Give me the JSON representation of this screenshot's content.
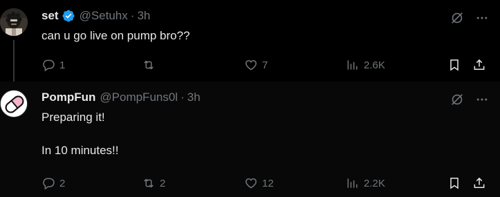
{
  "tweets": [
    {
      "name": "set",
      "handle": "@Setuhx",
      "separator": "·",
      "time": "3h",
      "verified": true,
      "lines": [
        "can u go live on pump bro??"
      ],
      "stats": {
        "replies": "1",
        "retweets": "",
        "likes": "7",
        "views": "2.6K"
      }
    },
    {
      "name": "PompFun",
      "handle": "@PompFuns0l",
      "separator": "·",
      "time": "3h",
      "verified": false,
      "lines": [
        "Preparing it!",
        "",
        "In 10 minutes!!"
      ],
      "stats": {
        "replies": "2",
        "retweets": "2",
        "likes": "12",
        "views": "2.2K"
      }
    }
  ],
  "colors": {
    "background": "#000000",
    "text": "#e7e9ea",
    "muted": "#71767b",
    "verified": "#1d9bf0",
    "pill_pink": "#f5b4c8"
  },
  "icons": [
    "grok-icon",
    "more-icon",
    "reply-icon",
    "retweet-icon",
    "like-icon",
    "views-icon",
    "bookmark-icon",
    "share-icon"
  ]
}
